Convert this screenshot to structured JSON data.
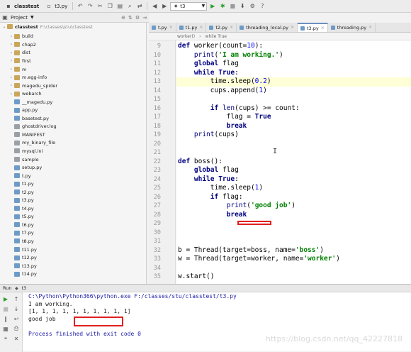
{
  "toolbar": {
    "tabs": [
      "classtest",
      "t3.py"
    ],
    "run_config": "t3"
  },
  "breadcrumb": {
    "project_label": "Project",
    "root_name": "classtest",
    "root_path": "F:\\classes\\stu\\classtest"
  },
  "tree": {
    "items": [
      {
        "label": "build",
        "kind": "folder",
        "arrow": "›"
      },
      {
        "label": "chap2",
        "kind": "folder",
        "arrow": "›"
      },
      {
        "label": "dist",
        "kind": "folder",
        "arrow": "›"
      },
      {
        "label": "first",
        "kind": "folder",
        "arrow": "›"
      },
      {
        "label": "m",
        "kind": "folder",
        "arrow": "›"
      },
      {
        "label": "m.egg-info",
        "kind": "folder",
        "arrow": "›"
      },
      {
        "label": "magedu_spider",
        "kind": "folder",
        "arrow": "›"
      },
      {
        "label": "webarch",
        "kind": "folder",
        "arrow": "›"
      },
      {
        "label": "__magedu.py",
        "kind": "py",
        "arrow": ""
      },
      {
        "label": "app.py",
        "kind": "py",
        "arrow": ""
      },
      {
        "label": "basetest.py",
        "kind": "py",
        "arrow": ""
      },
      {
        "label": "ghostdriver.log",
        "kind": "txt",
        "arrow": ""
      },
      {
        "label": "MANIFEST",
        "kind": "txt",
        "arrow": ""
      },
      {
        "label": "my_binary_file",
        "kind": "txt",
        "arrow": ""
      },
      {
        "label": "mysql.ini",
        "kind": "txt",
        "arrow": ""
      },
      {
        "label": "sample",
        "kind": "txt",
        "arrow": ""
      },
      {
        "label": "setup.py",
        "kind": "py",
        "arrow": ""
      },
      {
        "label": "t.py",
        "kind": "py",
        "arrow": ""
      },
      {
        "label": "t1.py",
        "kind": "py",
        "arrow": ""
      },
      {
        "label": "t2.py",
        "kind": "py",
        "arrow": ""
      },
      {
        "label": "t3.py",
        "kind": "py",
        "arrow": ""
      },
      {
        "label": "t4.py",
        "kind": "py",
        "arrow": ""
      },
      {
        "label": "t5.py",
        "kind": "py",
        "arrow": ""
      },
      {
        "label": "t6.py",
        "kind": "py",
        "arrow": ""
      },
      {
        "label": "t7.py",
        "kind": "py",
        "arrow": ""
      },
      {
        "label": "t8.py",
        "kind": "py",
        "arrow": ""
      },
      {
        "label": "t11.py",
        "kind": "py",
        "arrow": ""
      },
      {
        "label": "t12.py",
        "kind": "py",
        "arrow": ""
      },
      {
        "label": "t13.py",
        "kind": "py",
        "arrow": ""
      },
      {
        "label": "t14.py",
        "kind": "py",
        "arrow": ""
      }
    ]
  },
  "editor": {
    "tabs": [
      {
        "label": "t.py",
        "active": false
      },
      {
        "label": "t1.py",
        "active": false
      },
      {
        "label": "t2.py",
        "active": false
      },
      {
        "label": "threading_local.py",
        "active": false
      },
      {
        "label": "t3.py",
        "active": true
      },
      {
        "label": "threading.py",
        "active": false
      }
    ],
    "crumb": [
      "worker()",
      "while True"
    ],
    "line_numbers": [
      "9",
      "10",
      "11",
      "12",
      "13",
      "14",
      "15",
      "16",
      "17",
      "18",
      "19",
      "20",
      "21",
      "22",
      "23",
      "24",
      "25",
      "26",
      "27",
      "28",
      "29",
      "30",
      "31",
      "32",
      "33",
      "34",
      "35"
    ]
  },
  "run": {
    "label": "Run",
    "config": "t3",
    "output": [
      "C:\\Python\\Python366\\python.exe F:/classes/stu/classtest/t3.py",
      "I am working.",
      "[1, 1, 1, 1, 1, 1, 1, 1, 1, 1]",
      "good job",
      "",
      "Process finished with exit code 0"
    ],
    "watermark": "https://blog.csdn.net/qq_42227818"
  },
  "colors": {
    "keyword": "#000080",
    "string": "#008000",
    "number": "#0000ff",
    "highlight": "#ffffd7",
    "annotation_red": "#e02020"
  }
}
